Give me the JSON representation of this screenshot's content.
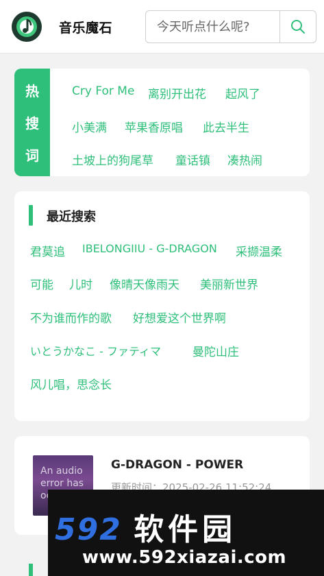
{
  "header": {
    "app_title": "音乐魔石",
    "search_placeholder": "今天听点什么呢?"
  },
  "hot": {
    "label_chars": [
      "热",
      "搜",
      "词"
    ],
    "tags": [
      "Cry For Me",
      "离别开出花",
      "起风了",
      "小美满",
      "苹果香原唱",
      "此去半生",
      "土坡上的狗尾草",
      "童话镇",
      "凑热闹"
    ]
  },
  "recent": {
    "title": "最近搜索",
    "tags": [
      "君莫追",
      "IBELONGIIU - G-DRAGON",
      "采撷温柔",
      "可能",
      "儿时",
      "像晴天像雨天",
      "美丽新世界",
      "不为谁而作的歌",
      "好想爱这个世界啊",
      "いとうかなこ - ファティマ",
      "曼陀山庄",
      "风儿唱，思念长"
    ]
  },
  "song": {
    "thumb_alt": "An audio error has occurred",
    "title": "G-DRAGON - POWER",
    "updated": "更新时间：2025-02-26 11:52:24"
  },
  "watermark": {
    "brand": "592",
    "brand_cn": "软件园",
    "url": "www.592xiazai.com"
  },
  "colors": {
    "accent": "#2ebf7a",
    "logo_bg": "#1e3a2f",
    "watermark_blue": "#2f6fe0"
  }
}
